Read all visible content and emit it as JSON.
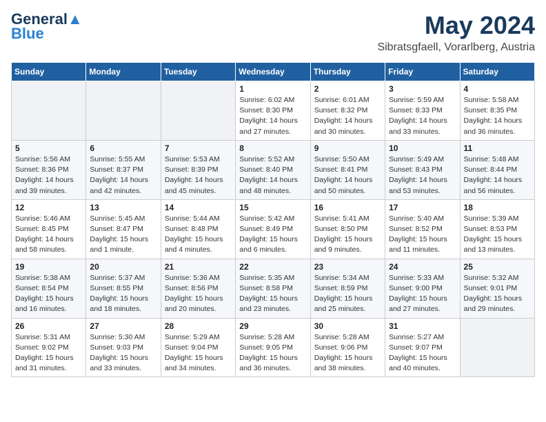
{
  "logo": {
    "line1": "General",
    "line2": "Blue"
  },
  "title": "May 2024",
  "location": "Sibratsgfaell, Vorarlberg, Austria",
  "days_of_week": [
    "Sunday",
    "Monday",
    "Tuesday",
    "Wednesday",
    "Thursday",
    "Friday",
    "Saturday"
  ],
  "weeks": [
    [
      {
        "day": "",
        "info": ""
      },
      {
        "day": "",
        "info": ""
      },
      {
        "day": "",
        "info": ""
      },
      {
        "day": "1",
        "info": "Sunrise: 6:02 AM\nSunset: 8:30 PM\nDaylight: 14 hours\nand 27 minutes."
      },
      {
        "day": "2",
        "info": "Sunrise: 6:01 AM\nSunset: 8:32 PM\nDaylight: 14 hours\nand 30 minutes."
      },
      {
        "day": "3",
        "info": "Sunrise: 5:59 AM\nSunset: 8:33 PM\nDaylight: 14 hours\nand 33 minutes."
      },
      {
        "day": "4",
        "info": "Sunrise: 5:58 AM\nSunset: 8:35 PM\nDaylight: 14 hours\nand 36 minutes."
      }
    ],
    [
      {
        "day": "5",
        "info": "Sunrise: 5:56 AM\nSunset: 8:36 PM\nDaylight: 14 hours\nand 39 minutes."
      },
      {
        "day": "6",
        "info": "Sunrise: 5:55 AM\nSunset: 8:37 PM\nDaylight: 14 hours\nand 42 minutes."
      },
      {
        "day": "7",
        "info": "Sunrise: 5:53 AM\nSunset: 8:39 PM\nDaylight: 14 hours\nand 45 minutes."
      },
      {
        "day": "8",
        "info": "Sunrise: 5:52 AM\nSunset: 8:40 PM\nDaylight: 14 hours\nand 48 minutes."
      },
      {
        "day": "9",
        "info": "Sunrise: 5:50 AM\nSunset: 8:41 PM\nDaylight: 14 hours\nand 50 minutes."
      },
      {
        "day": "10",
        "info": "Sunrise: 5:49 AM\nSunset: 8:43 PM\nDaylight: 14 hours\nand 53 minutes."
      },
      {
        "day": "11",
        "info": "Sunrise: 5:48 AM\nSunset: 8:44 PM\nDaylight: 14 hours\nand 56 minutes."
      }
    ],
    [
      {
        "day": "12",
        "info": "Sunrise: 5:46 AM\nSunset: 8:45 PM\nDaylight: 14 hours\nand 58 minutes."
      },
      {
        "day": "13",
        "info": "Sunrise: 5:45 AM\nSunset: 8:47 PM\nDaylight: 15 hours\nand 1 minute."
      },
      {
        "day": "14",
        "info": "Sunrise: 5:44 AM\nSunset: 8:48 PM\nDaylight: 15 hours\nand 4 minutes."
      },
      {
        "day": "15",
        "info": "Sunrise: 5:42 AM\nSunset: 8:49 PM\nDaylight: 15 hours\nand 6 minutes."
      },
      {
        "day": "16",
        "info": "Sunrise: 5:41 AM\nSunset: 8:50 PM\nDaylight: 15 hours\nand 9 minutes."
      },
      {
        "day": "17",
        "info": "Sunrise: 5:40 AM\nSunset: 8:52 PM\nDaylight: 15 hours\nand 11 minutes."
      },
      {
        "day": "18",
        "info": "Sunrise: 5:39 AM\nSunset: 8:53 PM\nDaylight: 15 hours\nand 13 minutes."
      }
    ],
    [
      {
        "day": "19",
        "info": "Sunrise: 5:38 AM\nSunset: 8:54 PM\nDaylight: 15 hours\nand 16 minutes."
      },
      {
        "day": "20",
        "info": "Sunrise: 5:37 AM\nSunset: 8:55 PM\nDaylight: 15 hours\nand 18 minutes."
      },
      {
        "day": "21",
        "info": "Sunrise: 5:36 AM\nSunset: 8:56 PM\nDaylight: 15 hours\nand 20 minutes."
      },
      {
        "day": "22",
        "info": "Sunrise: 5:35 AM\nSunset: 8:58 PM\nDaylight: 15 hours\nand 23 minutes."
      },
      {
        "day": "23",
        "info": "Sunrise: 5:34 AM\nSunset: 8:59 PM\nDaylight: 15 hours\nand 25 minutes."
      },
      {
        "day": "24",
        "info": "Sunrise: 5:33 AM\nSunset: 9:00 PM\nDaylight: 15 hours\nand 27 minutes."
      },
      {
        "day": "25",
        "info": "Sunrise: 5:32 AM\nSunset: 9:01 PM\nDaylight: 15 hours\nand 29 minutes."
      }
    ],
    [
      {
        "day": "26",
        "info": "Sunrise: 5:31 AM\nSunset: 9:02 PM\nDaylight: 15 hours\nand 31 minutes."
      },
      {
        "day": "27",
        "info": "Sunrise: 5:30 AM\nSunset: 9:03 PM\nDaylight: 15 hours\nand 33 minutes."
      },
      {
        "day": "28",
        "info": "Sunrise: 5:29 AM\nSunset: 9:04 PM\nDaylight: 15 hours\nand 34 minutes."
      },
      {
        "day": "29",
        "info": "Sunrise: 5:28 AM\nSunset: 9:05 PM\nDaylight: 15 hours\nand 36 minutes."
      },
      {
        "day": "30",
        "info": "Sunrise: 5:28 AM\nSunset: 9:06 PM\nDaylight: 15 hours\nand 38 minutes."
      },
      {
        "day": "31",
        "info": "Sunrise: 5:27 AM\nSunset: 9:07 PM\nDaylight: 15 hours\nand 40 minutes."
      },
      {
        "day": "",
        "info": ""
      }
    ]
  ]
}
